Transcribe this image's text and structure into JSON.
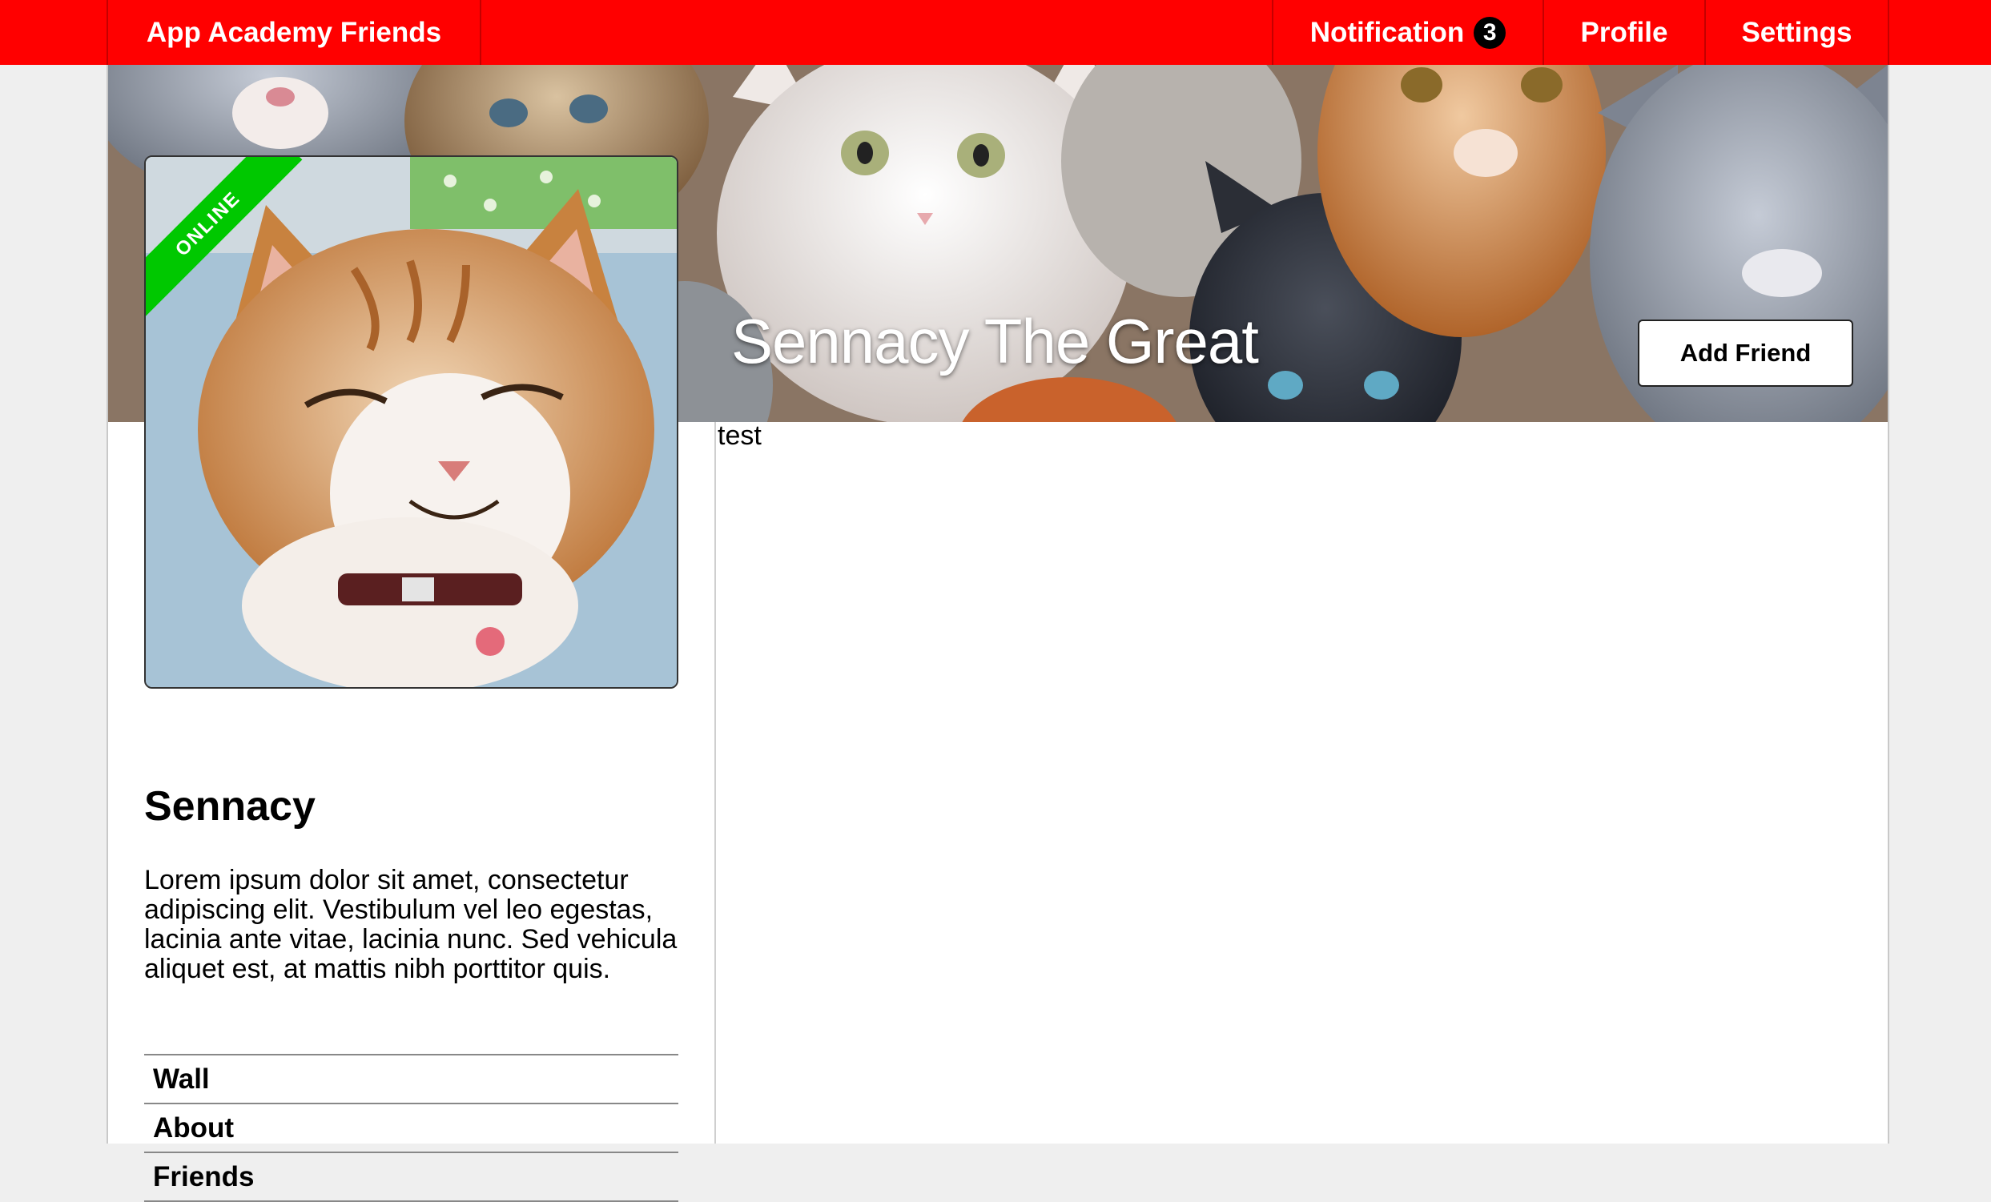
{
  "nav": {
    "brand": "App Academy Friends",
    "notification_label": "Notification",
    "notification_count": "3",
    "profile_label": "Profile",
    "settings_label": "Settings"
  },
  "cover": {
    "title": "Sennacy The Great",
    "add_friend_label": "Add Friend"
  },
  "profile": {
    "status": "ONLINE",
    "name": "Sennacy",
    "bio": "Lorem ipsum dolor sit amet, consectetur adipiscing elit. Vestibulum vel leo egestas, lacinia ante vitae, lacinia nunc. Sed vehicula aliquet est, at mattis nibh porttitor quis.",
    "menu": [
      {
        "label": "Wall"
      },
      {
        "label": "About"
      },
      {
        "label": "Friends"
      }
    ]
  },
  "content": {
    "text": "test"
  },
  "colors": {
    "nav_bg": "#ff0000",
    "online_ribbon": "#00c800",
    "page_bg": "#efefef"
  }
}
